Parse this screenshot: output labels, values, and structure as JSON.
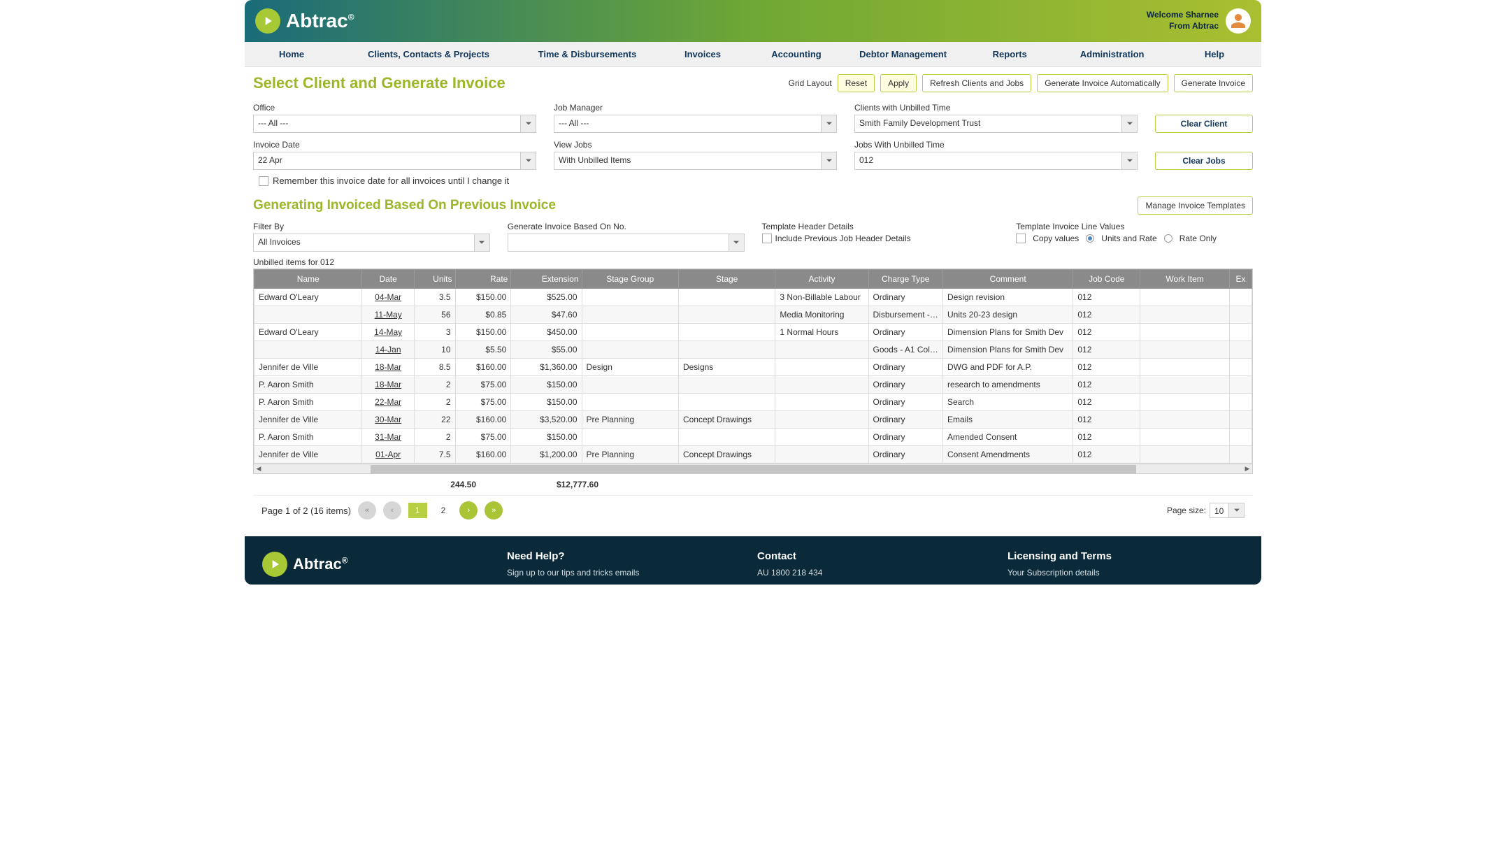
{
  "header": {
    "brand": "Abtrac",
    "welcome_line1": "Welcome Sharnee",
    "welcome_line2": "From Abtrac"
  },
  "nav": [
    "Home",
    "Clients, Contacts & Projects",
    "Time & Disbursements",
    "Invoices",
    "Accounting",
    "Debtor Management",
    "Reports",
    "Administration",
    "Help"
  ],
  "page": {
    "title": "Select Client and Generate Invoice",
    "grid_layout_label": "Grid Layout",
    "reset_btn": "Reset",
    "apply_btn": "Apply",
    "refresh_btn": "Refresh Clients and Jobs",
    "auto_btn": "Generate Invoice Automatically",
    "gen_btn": "Generate Invoice"
  },
  "filters": {
    "office_label": "Office",
    "office_value": "--- All ---",
    "manager_label": "Job Manager",
    "manager_value": "--- All ---",
    "clients_label": "Clients with Unbilled Time",
    "clients_value": "Smith Family Development Trust",
    "clear_client_btn": "Clear Client",
    "invdate_label": "Invoice Date",
    "invdate_value": "22 Apr",
    "viewjobs_label": "View Jobs",
    "viewjobs_value": "With Unbilled Items",
    "jobs_label": "Jobs With Unbilled Time",
    "jobs_value": "012",
    "clear_jobs_btn": "Clear Jobs",
    "remember_label": "Remember this invoice date for all invoices until I change it"
  },
  "gen": {
    "title": "Generating Invoiced Based On Previous Invoice",
    "manage_btn": "Manage Invoice Templates",
    "filterby_label": "Filter By",
    "filterby_value": "All Invoices",
    "basedon_label": "Generate Invoice Based On No.",
    "templatehdr_label": "Template Header Details",
    "includeprev_label": "Include Previous Job Header Details",
    "linevals_label": "Template Invoice Line Values",
    "opt_copy": "Copy values",
    "opt_unitsrate": "Units and Rate",
    "opt_rateonly": "Rate Only"
  },
  "table": {
    "caption": "Unbilled items for 012",
    "headers": [
      "Name",
      "Date",
      "Units",
      "Rate",
      "Extension",
      "Stage Group",
      "Stage",
      "Activity",
      "Charge Type",
      "Comment",
      "Job Code",
      "Work Item",
      "Ex"
    ],
    "rows": [
      {
        "name": "Edward O'Leary",
        "date": "04-Mar",
        "units": "3.5",
        "rate": "$150.00",
        "ext": "$525.00",
        "sg": "",
        "stage": "",
        "act": "3 Non-Billable Labour",
        "ct": "Ordinary",
        "cmt": "Design revision",
        "jc": "012",
        "wi": ""
      },
      {
        "name": "",
        "date": "11-May",
        "units": "56",
        "rate": "$0.85",
        "ext": "$47.60",
        "sg": "",
        "stage": "",
        "act": "Media Monitoring",
        "ct": "Disbursement - ...",
        "cmt": "Units 20-23 design",
        "jc": "012",
        "wi": ""
      },
      {
        "name": "Edward O'Leary",
        "date": "14-May",
        "units": "3",
        "rate": "$150.00",
        "ext": "$450.00",
        "sg": "",
        "stage": "",
        "act": "1 Normal Hours",
        "ct": "Ordinary",
        "cmt": "Dimension Plans for Smith Dev",
        "jc": "012",
        "wi": ""
      },
      {
        "name": "",
        "date": "14-Jan",
        "units": "10",
        "rate": "$5.50",
        "ext": "$55.00",
        "sg": "",
        "stage": "",
        "act": "",
        "ct": "Goods - A1 Colo...",
        "cmt": "Dimension Plans for Smith Dev",
        "jc": "012",
        "wi": ""
      },
      {
        "name": "Jennifer de Ville",
        "date": "18-Mar",
        "units": "8.5",
        "rate": "$160.00",
        "ext": "$1,360.00",
        "sg": "Design",
        "stage": "Designs",
        "act": "",
        "ct": "Ordinary",
        "cmt": "DWG and PDF for A.P.",
        "jc": "012",
        "wi": ""
      },
      {
        "name": "P. Aaron Smith",
        "date": "18-Mar",
        "units": "2",
        "rate": "$75.00",
        "ext": "$150.00",
        "sg": "",
        "stage": "",
        "act": "",
        "ct": "Ordinary",
        "cmt": "research to amendments",
        "jc": "012",
        "wi": ""
      },
      {
        "name": "P. Aaron Smith",
        "date": "22-Mar",
        "units": "2",
        "rate": "$75.00",
        "ext": "$150.00",
        "sg": "",
        "stage": "",
        "act": "",
        "ct": "Ordinary",
        "cmt": "Search",
        "jc": "012",
        "wi": ""
      },
      {
        "name": "Jennifer de Ville",
        "date": "30-Mar",
        "units": "22",
        "rate": "$160.00",
        "ext": "$3,520.00",
        "sg": "Pre Planning",
        "stage": "Concept Drawings",
        "act": "",
        "ct": "Ordinary",
        "cmt": "Emails",
        "jc": "012",
        "wi": ""
      },
      {
        "name": "P. Aaron Smith",
        "date": "31-Mar",
        "units": "2",
        "rate": "$75.00",
        "ext": "$150.00",
        "sg": "",
        "stage": "",
        "act": "",
        "ct": "Ordinary",
        "cmt": "Amended Consent",
        "jc": "012",
        "wi": ""
      },
      {
        "name": "Jennifer de Ville",
        "date": "01-Apr",
        "units": "7.5",
        "rate": "$160.00",
        "ext": "$1,200.00",
        "sg": "Pre Planning",
        "stage": "Concept Drawings",
        "act": "",
        "ct": "Ordinary",
        "cmt": "Consent Amendments",
        "jc": "012",
        "wi": ""
      }
    ],
    "totals": {
      "units": "244.50",
      "ext": "$12,777.60"
    }
  },
  "pager": {
    "info": "Page 1 of 2 (16 items)",
    "page1": "1",
    "page2": "2",
    "size_label": "Page size:",
    "size_value": "10"
  },
  "footer": {
    "help_title": "Need Help?",
    "help_text": "Sign up to our tips and tricks emails",
    "contact_title": "Contact",
    "contact_text": "AU 1800 218 434",
    "lic_title": "Licensing and Terms",
    "lic_text": "Your Subscription details"
  }
}
